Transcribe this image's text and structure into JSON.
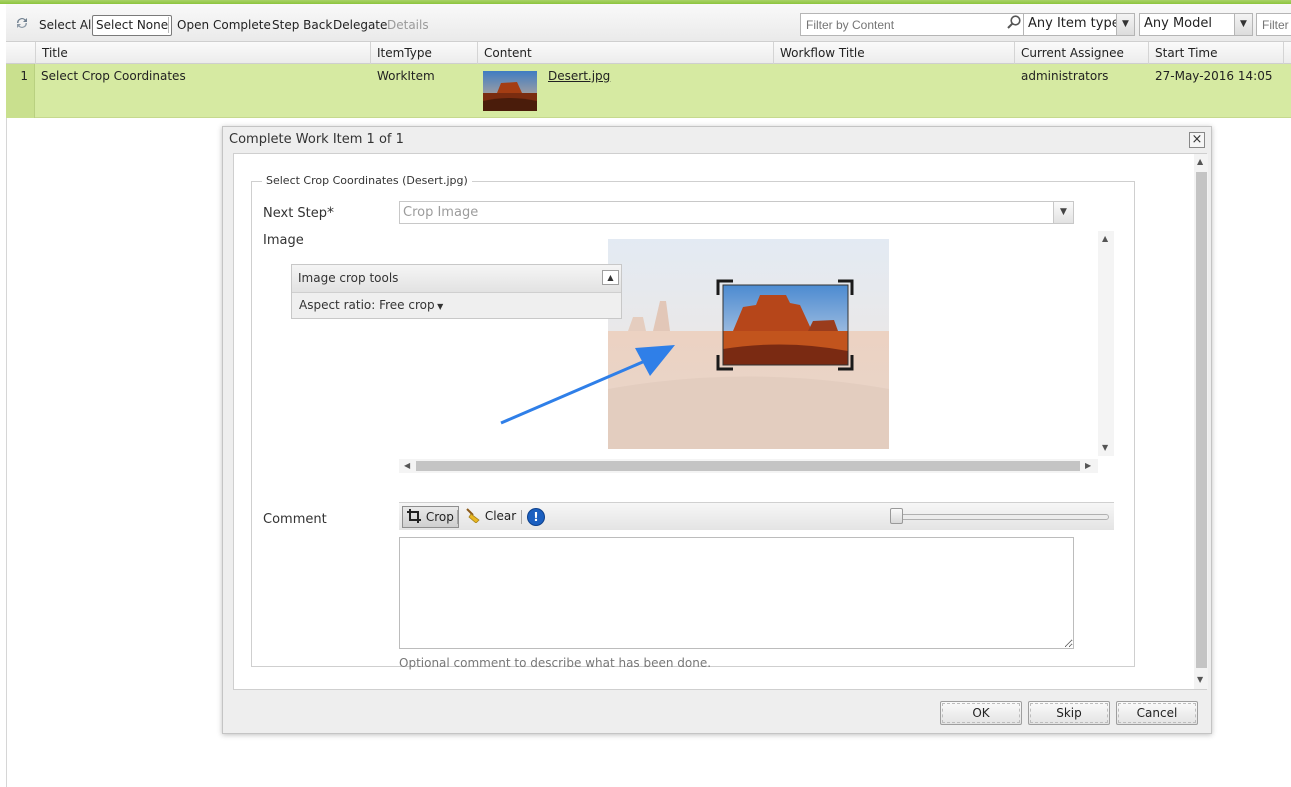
{
  "toolbar": {
    "select_all": "Select All",
    "select_none": "Select None",
    "open": "Open",
    "complete": "Complete",
    "step_back": "Step Back",
    "delegate": "Delegate",
    "details": "Details",
    "filter_content_placeholder": "Filter by Content",
    "item_type": "Any Item type",
    "model": "Any Model",
    "filter_placeholder": "Filter"
  },
  "grid": {
    "columns": [
      "Title",
      "ItemType",
      "Content",
      "Workflow Title",
      "Current Assignee",
      "Start Time"
    ],
    "rows": [
      {
        "num": "1",
        "title": "Select Crop Coordinates",
        "item_type": "WorkItem",
        "content_link": "Desert.jpg",
        "workflow_title": "",
        "assignee": "administrators",
        "start_time": "27-May-2016 14:05"
      }
    ]
  },
  "dialog": {
    "title": "Complete Work Item 1 of 1",
    "close": "×",
    "legend": "Select Crop Coordinates (Desert.jpg)",
    "next_step_label": "Next Step",
    "required_mark": "*",
    "next_step_value": "Crop Image",
    "image_label": "Image",
    "crop_tools_title": "Image crop tools",
    "aspect_ratio": "Aspect ratio: Free crop",
    "crop_button": "Crop",
    "clear_button": "Clear",
    "info_button": "!",
    "comment_label": "Comment",
    "comment_value": "",
    "comment_help": "Optional comment to describe what has been done.",
    "ok": "OK",
    "skip": "Skip",
    "cancel": "Cancel"
  }
}
